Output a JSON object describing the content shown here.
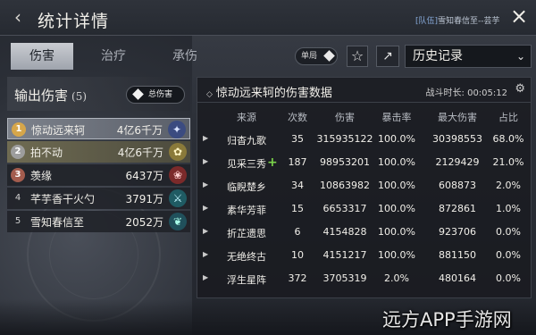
{
  "header": {
    "back_icon": "back-arrow-icon",
    "title": "统计详情",
    "team_tag": "[队伍]",
    "team_text": "雪知春信至--芸芋",
    "close_icon": "close-icon"
  },
  "tabs": [
    {
      "label": "伤害",
      "active": true
    },
    {
      "label": "治疗",
      "active": false
    },
    {
      "label": "承伤",
      "active": false
    }
  ],
  "controls": {
    "single_label": "单局",
    "star_icon": "star-icon",
    "share_icon": "share-icon",
    "history_label": "历史记录",
    "chevron_icon": "chevron-down-icon"
  },
  "left_panel": {
    "title": "输出伤害",
    "count": "(5)",
    "total_label": "总伤害",
    "ranks": [
      {
        "rank": "1",
        "name": "惊动远来轲",
        "value": "4亿6千万",
        "icon": "wing-icon"
      },
      {
        "rank": "2",
        "name": "拍不动",
        "value": "4亿6千万",
        "icon": "flower-icon"
      },
      {
        "rank": "3",
        "name": "羡缘",
        "value": "6437万",
        "icon": "lotus-icon"
      },
      {
        "rank": "4",
        "name": "芊芋香干火勺",
        "value": "3791万",
        "icon": "blade-icon"
      },
      {
        "rank": "5",
        "name": "雪知春信至",
        "value": "2052万",
        "icon": "butterfly-icon"
      }
    ]
  },
  "right_panel": {
    "title": "惊动远来轲的伤害数据",
    "duration": "战斗时长: 00:05:12",
    "gear_icon": "gear-icon",
    "columns": [
      "来源",
      "次数",
      "伤害",
      "暴击率",
      "最大伤害",
      "占比"
    ],
    "rows": [
      [
        "归杳九歌",
        "35",
        "315935122",
        "100.0%",
        "30398553",
        "68.0%"
      ],
      [
        "见采三秀",
        "187",
        "98953201",
        "100.0%",
        "2129429",
        "21.0%"
      ],
      [
        "临睨楚乡",
        "34",
        "10863982",
        "100.0%",
        "608873",
        "2.0%"
      ],
      [
        "素华芳菲",
        "15",
        "6653317",
        "100.0%",
        "872861",
        "1.0%"
      ],
      [
        "折芷遗思",
        "6",
        "4154828",
        "100.0%",
        "923706",
        "0.0%"
      ],
      [
        "无绝终古",
        "10",
        "4151217",
        "100.0%",
        "881150",
        "0.0%"
      ],
      [
        "浮生星阵",
        "372",
        "3705319",
        "2.0%",
        "480164",
        "0.0%"
      ]
    ]
  },
  "watermark": "远方APP手游网",
  "colors": {
    "background": "#23262d",
    "accent_green": "#7bd44a",
    "tab_active": "#c9ccd1"
  }
}
